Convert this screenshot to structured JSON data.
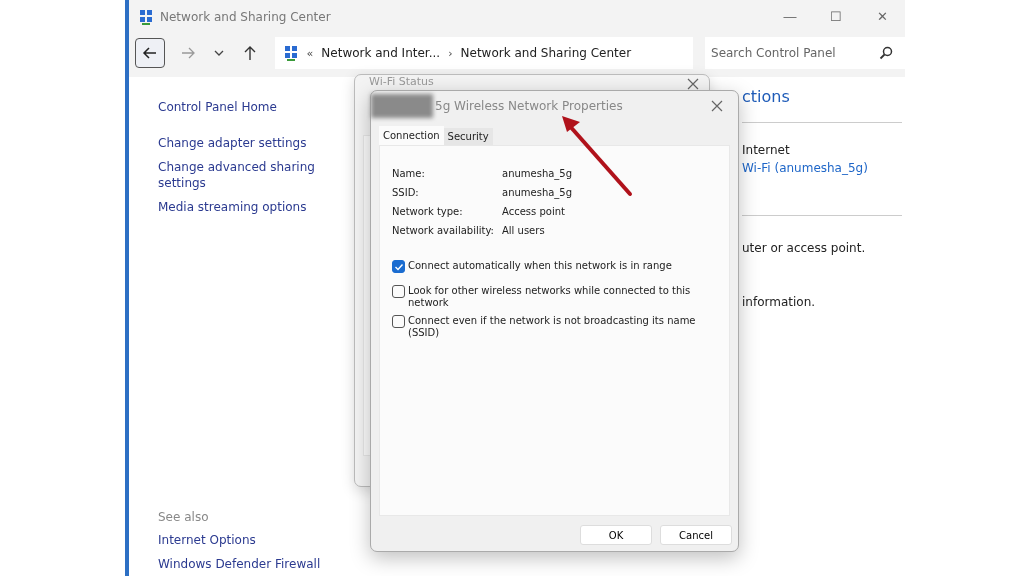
{
  "window": {
    "title": "Network and Sharing Center",
    "controls": [
      "—",
      "☐",
      "✕"
    ]
  },
  "address_bar": {
    "separator": "«",
    "crumbs": [
      "Network and Inter...",
      "Network and Sharing Center"
    ],
    "crumb_separator": "›"
  },
  "search": {
    "placeholder": "Search Control Panel"
  },
  "sidebar": {
    "items": [
      "Control Panel Home",
      "Change adapter settings",
      "Change advanced sharing settings",
      "Media streaming options"
    ],
    "see_also_title": "See also",
    "see_also": [
      "Internet Options",
      "Windows Defender Firewall"
    ]
  },
  "main": {
    "heading": "ctions",
    "access_type": "Internet",
    "connection_link": "Wi-Fi (anumesha_5g)",
    "text_1": "uter or access point.",
    "text_2": "information."
  },
  "status_dialog": {
    "title": "Wi-Fi Status"
  },
  "properties_dialog": {
    "title": "5g Wireless Network Properties",
    "tabs": [
      {
        "label": "Connection",
        "selected": true
      },
      {
        "label": "Security",
        "selected": false
      }
    ],
    "fields": [
      {
        "label": "Name:",
        "value": "anumesha_5g"
      },
      {
        "label": "SSID:",
        "value": "anumesha_5g"
      },
      {
        "label": "Network type:",
        "value": "Access point"
      },
      {
        "label": "Network availability:",
        "value": "All users"
      }
    ],
    "options": [
      {
        "label": "Connect automatically when this network is in range",
        "checked": true
      },
      {
        "label": "Look for other wireless networks while connected to this network",
        "checked": false
      },
      {
        "label": "Connect even if the network is not broadcasting its name (SSID)",
        "checked": false
      }
    ],
    "buttons": [
      "OK",
      "Cancel"
    ]
  }
}
